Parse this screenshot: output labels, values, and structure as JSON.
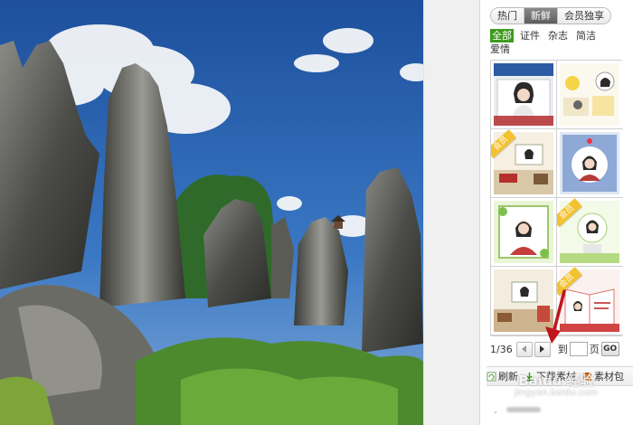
{
  "panel": {
    "tabs": [
      {
        "label": "热门",
        "active": false
      },
      {
        "label": "新鲜",
        "active": true
      },
      {
        "label": "会员独享",
        "active": false
      }
    ],
    "categories": [
      {
        "label": "全部",
        "active": true
      },
      {
        "label": "证件",
        "active": false
      },
      {
        "label": "杂志",
        "active": false
      },
      {
        "label": "简洁",
        "active": false
      },
      {
        "label": "爱情",
        "active": false
      }
    ],
    "thumbnails": [
      {
        "vip": false,
        "badge": ""
      },
      {
        "vip": false,
        "badge": ""
      },
      {
        "vip": true,
        "badge": "会员"
      },
      {
        "vip": false,
        "badge": ""
      },
      {
        "vip": false,
        "badge": ""
      },
      {
        "vip": true,
        "badge": "会员"
      },
      {
        "vip": false,
        "badge": ""
      },
      {
        "vip": true,
        "badge": "会员"
      }
    ],
    "pager": {
      "status": "1/36",
      "goto_label": "到",
      "page_unit": "页",
      "page_input_value": "",
      "go_label": "GO"
    }
  },
  "bottombar": {
    "refresh_label": "刷新",
    "download_label": "下载素材",
    "library_label": "素材包"
  },
  "watermark": {
    "brand": "Baidu 经验",
    "url": "jingyan.baidu.com"
  },
  "colors": {
    "accent_green": "#3e9a1e",
    "vip_badge": "#f2c230",
    "arrow_red": "#c0151b",
    "active_tab": "#6a6a6a"
  }
}
